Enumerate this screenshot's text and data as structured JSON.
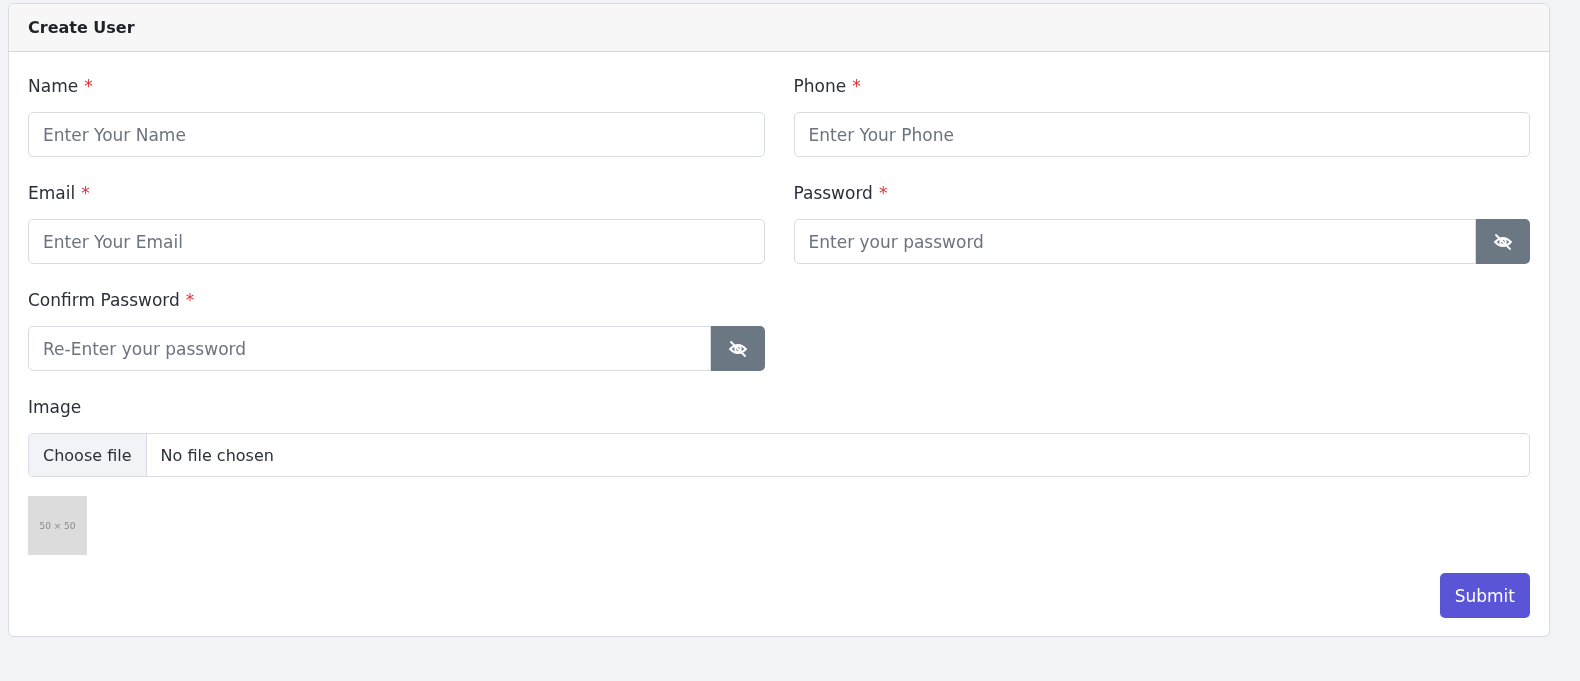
{
  "card": {
    "title": "Create User"
  },
  "fields": [
    {
      "kind": "text",
      "label": "Name",
      "required_mark": "*",
      "placeholder": "Enter Your Name"
    },
    {
      "kind": "text",
      "label": "Phone",
      "required_mark": "*",
      "placeholder": "Enter Your Phone"
    },
    {
      "kind": "text",
      "label": "Email",
      "required_mark": "*",
      "placeholder": "Enter Your Email"
    },
    {
      "kind": "password",
      "label": "Password",
      "required_mark": "*",
      "placeholder": "Enter your password"
    },
    {
      "kind": "password",
      "label": "Confirm Password",
      "required_mark": "*",
      "placeholder": "Re-Enter your password"
    },
    {
      "kind": "file",
      "label": "Image",
      "button": "Choose file",
      "status": "No file chosen"
    }
  ],
  "preview": {
    "text": "50 × 50"
  },
  "submit": "Submit"
}
